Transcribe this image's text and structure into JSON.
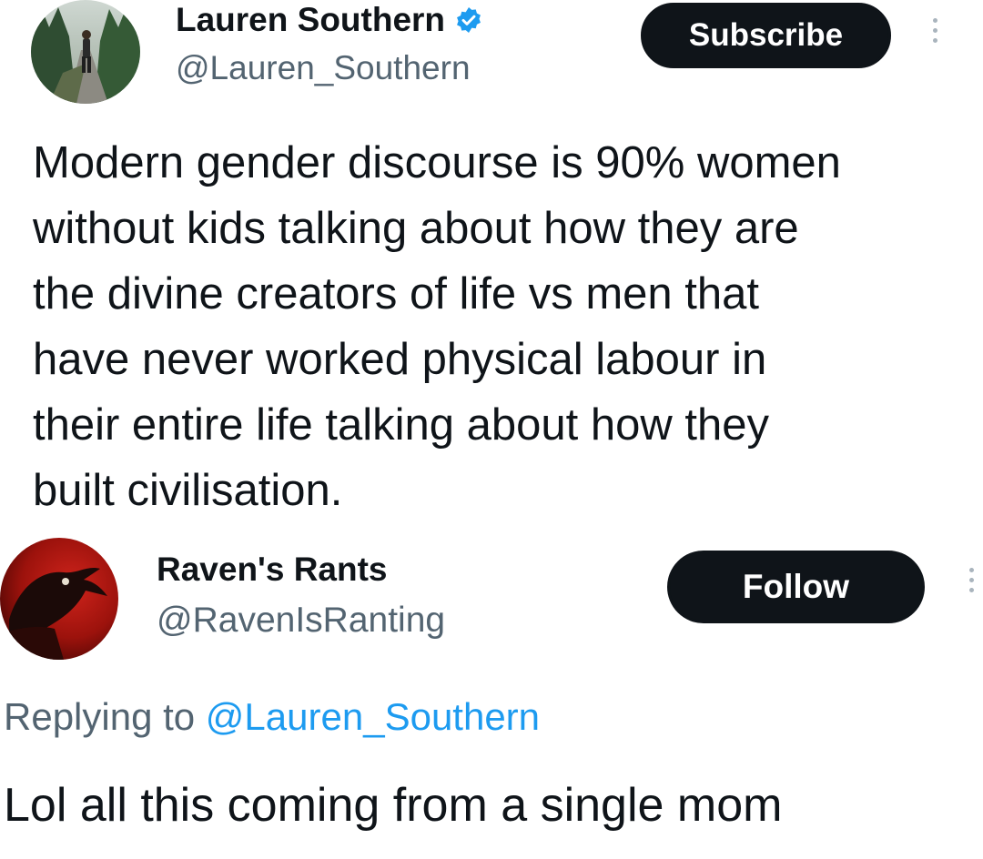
{
  "tweet": {
    "author": {
      "name": "Lauren Southern",
      "handle": "@Lauren_Southern",
      "verified": true,
      "avatar": "forest-path-photo"
    },
    "action_label": "Subscribe",
    "more_icon": "vertical-ellipsis-icon",
    "text": "Modern gender discourse is 90% women\nwithout kids talking about how they are\nthe divine creators of life vs men that\nhave never worked physical labour in\ntheir entire life talking about how they\nbuilt civilisation."
  },
  "reply": {
    "author": {
      "name": "Raven's Rants",
      "handle": "@RavenIsRanting",
      "avatar": "red-raven-image"
    },
    "action_label": "Follow",
    "more_icon": "vertical-ellipsis-icon",
    "replying_prefix": "Replying to",
    "replying_to": "@Lauren_Southern",
    "text": "Lol all this coming from a single mom"
  },
  "colors": {
    "text": "#0f1419",
    "secondary": "#536471",
    "link": "#1d9bf0",
    "button_bg": "#0f1419",
    "verified_badge": "#1d9bf0"
  }
}
